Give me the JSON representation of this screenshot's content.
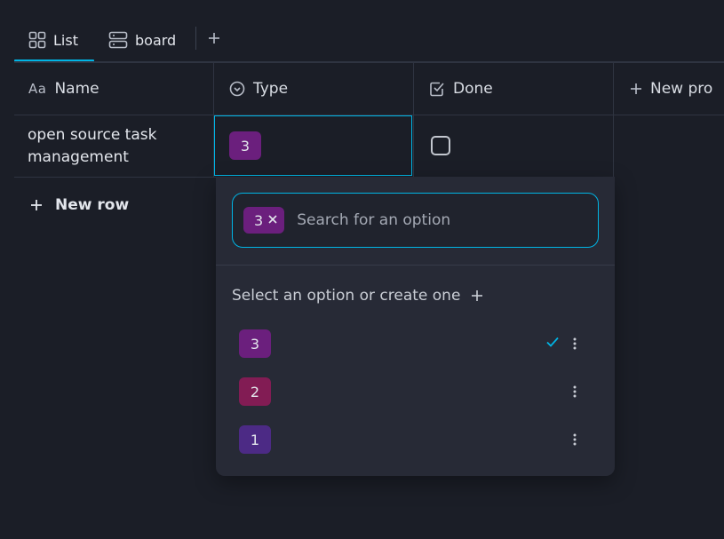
{
  "tabs": [
    {
      "label": "List",
      "icon": "grid-icon",
      "active": true
    },
    {
      "label": "board",
      "icon": "board-icon",
      "active": false
    }
  ],
  "add_view_label": "+",
  "columns": [
    {
      "label": "Name",
      "icon_text": "Aa"
    },
    {
      "label": "Type",
      "icon": "select-circle-icon"
    },
    {
      "label": "Done",
      "icon": "checkbox-icon"
    },
    {
      "label": "New pro",
      "icon": "plus-icon"
    }
  ],
  "row": {
    "name": "open source task management",
    "type_tag": "3",
    "done": false
  },
  "new_row_label": "New row",
  "popover": {
    "selected_chip": "3",
    "search_placeholder": "Search for an option",
    "hint": "Select an option or create one",
    "options": [
      {
        "label": "3",
        "color": "#6b1f7d",
        "selected": true
      },
      {
        "label": "2",
        "color": "#821c54",
        "selected": false
      },
      {
        "label": "1",
        "color": "#4c2a85",
        "selected": false
      }
    ]
  },
  "colors": {
    "accent": "#00b5e5",
    "background": "#1b1e27",
    "popover": "#272a36"
  }
}
